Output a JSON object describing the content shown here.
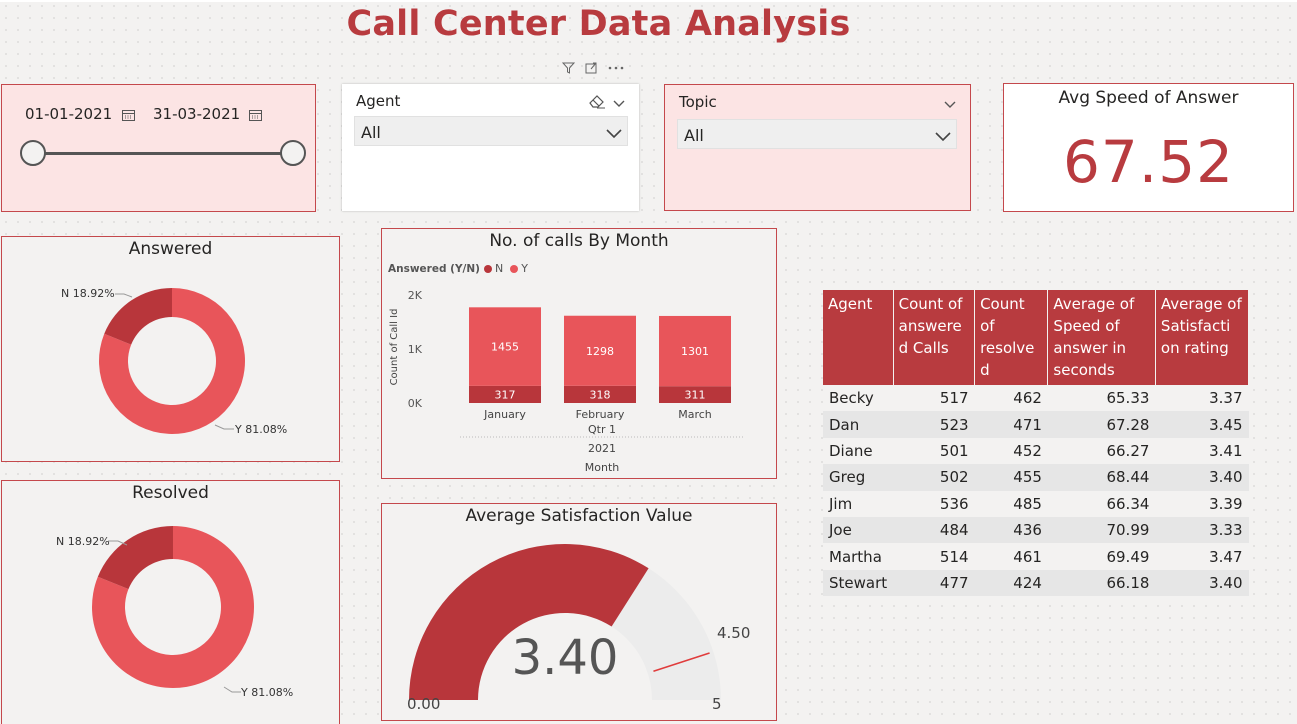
{
  "title": "Call Center Data Analysis",
  "date_slicer": {
    "start": "01-01-2021",
    "end": "31-03-2021"
  },
  "agent_slicer": {
    "label": "Agent",
    "value": "All"
  },
  "topic_slicer": {
    "label": "Topic",
    "value": "All"
  },
  "kpi": {
    "title": "Avg Speed of Answer",
    "value": "67.52"
  },
  "answered_donut": {
    "title": "Answered",
    "n_label": "N 18.92%",
    "y_label": "Y 81.08%",
    "n_pct": 18.92,
    "y_pct": 81.08
  },
  "resolved_donut": {
    "title": "Resolved",
    "n_label": "N 18.92%",
    "y_label": "Y 81.08%",
    "n_pct": 18.92,
    "y_pct": 81.08
  },
  "chart_data": {
    "type": "bar",
    "title": "No. of calls By Month",
    "legend_title": "Answered (Y/N)",
    "legend": [
      "N",
      "Y"
    ],
    "categories": [
      "January",
      "February",
      "March"
    ],
    "series": [
      {
        "name": "N",
        "values": [
          317,
          318,
          311
        ],
        "color": "#b8363b"
      },
      {
        "name": "Y",
        "values": [
          1455,
          1298,
          1301
        ],
        "color": "#e8555a"
      }
    ],
    "stacked": true,
    "ylabel": "Count of Call Id",
    "xlabel": "Month",
    "x_group_labels": [
      "Qtr 1",
      "2021"
    ],
    "yticks": [
      "0K",
      "1K",
      "2K"
    ],
    "ylim": [
      0,
      2000
    ]
  },
  "gauge": {
    "title": "Average Satisfaction Value",
    "value": 3.4,
    "value_label": "3.40",
    "min_label": "0.00",
    "max_label": "5",
    "target_label": "4.50",
    "min": 0,
    "max": 5,
    "target": 4.5
  },
  "agent_table": {
    "columns": [
      "Agent",
      "Count of answere d Calls",
      "Count of resolve d",
      "Average of Speed of answer in seconds",
      "Average of Satisfacti on rating"
    ],
    "rows": [
      [
        "Becky",
        "517",
        "462",
        "65.33",
        "3.37"
      ],
      [
        "Dan",
        "523",
        "471",
        "67.28",
        "3.45"
      ],
      [
        "Diane",
        "501",
        "452",
        "66.27",
        "3.41"
      ],
      [
        "Greg",
        "502",
        "455",
        "68.44",
        "3.40"
      ],
      [
        "Jim",
        "536",
        "485",
        "66.34",
        "3.39"
      ],
      [
        "Joe",
        "484",
        "436",
        "70.99",
        "3.33"
      ],
      [
        "Martha",
        "514",
        "461",
        "69.49",
        "3.47"
      ],
      [
        "Stewart",
        "477",
        "424",
        "66.18",
        "3.40"
      ]
    ]
  },
  "colors": {
    "accent": "#b83b3f",
    "dark_red": "#b8363b",
    "light_red": "#e8555a",
    "slicer_bg": "#fce4e4"
  }
}
